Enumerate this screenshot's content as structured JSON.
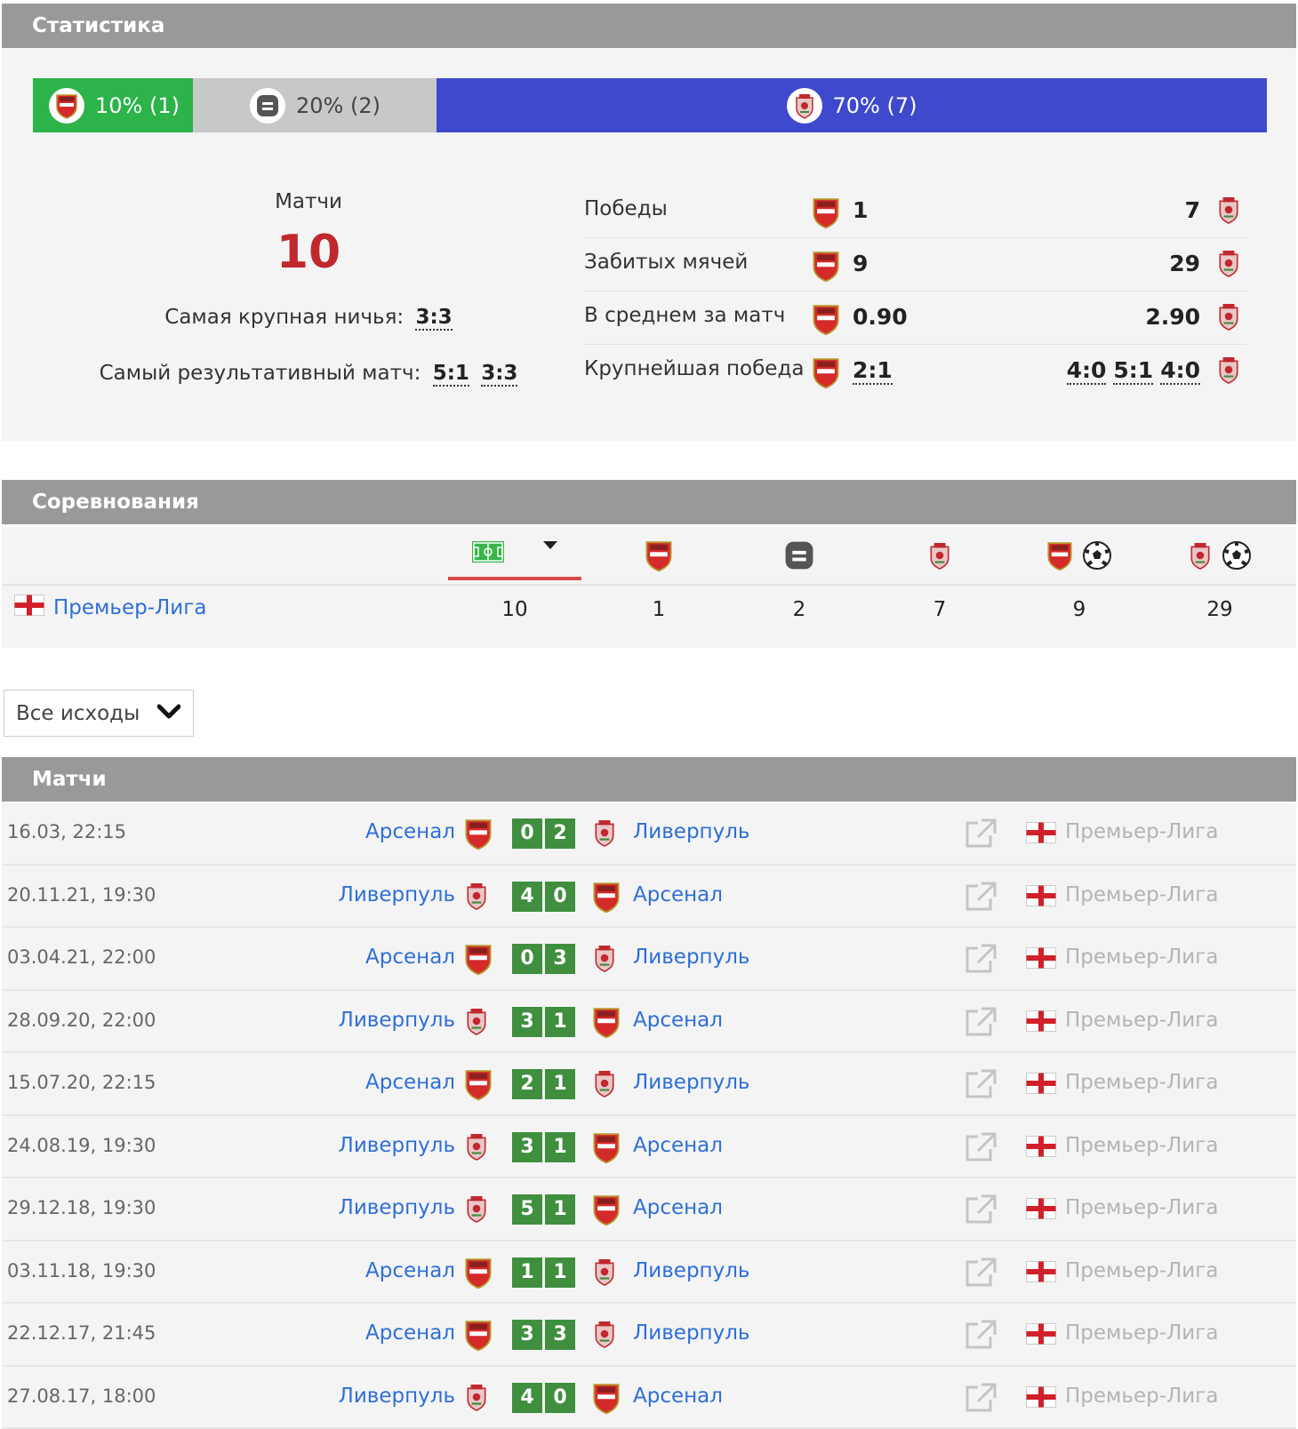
{
  "stats": {
    "header": "Статистика",
    "ratio": [
      {
        "label": "10% (1)",
        "percent": 10,
        "count": 1,
        "icon": "arsenal-crest-icon",
        "color": "#2cb34a"
      },
      {
        "label": "20% (2)",
        "percent": 20,
        "count": 2,
        "icon": "draw-icon",
        "color": "#c8c8c8"
      },
      {
        "label": "70% (7)",
        "percent": 70,
        "count": 7,
        "icon": "liverpool-crest-icon",
        "color": "#3e49cd"
      }
    ],
    "matches_label": "Матчи",
    "matches_count": "10",
    "biggest_draw_label": "Самая крупная ничья:",
    "biggest_draw_score": "3:3",
    "most_goals_label": "Самый результативный матч:",
    "most_goals_scores": [
      "5:1",
      "3:3"
    ],
    "rows": [
      {
        "name": "Победы",
        "left": "1",
        "right": [
          "7"
        ],
        "right_underlined": false,
        "left_underlined": false
      },
      {
        "name": "Забитых мячей",
        "left": "9",
        "right": [
          "29"
        ],
        "right_underlined": false,
        "left_underlined": false
      },
      {
        "name": "В среднем за матч",
        "left": "0.90",
        "right": [
          "2.90"
        ],
        "right_underlined": false,
        "left_underlined": false
      },
      {
        "name": "Крупнейшая победа",
        "left": "2:1",
        "right": [
          "4:0",
          "5:1",
          "4:0"
        ],
        "right_underlined": true,
        "left_underlined": true
      }
    ]
  },
  "competitions": {
    "header": "Соревнования",
    "columns": [
      "matches-field-icon",
      "arsenal-crest-icon",
      "draw-icon",
      "liverpool-crest-icon",
      "arsenal-goals-icon",
      "liverpool-goals-icon"
    ],
    "row": {
      "name": "Премьер-Лига",
      "values": [
        "10",
        "1",
        "2",
        "7",
        "9",
        "29"
      ]
    }
  },
  "filter": {
    "selected": "Все исходы"
  },
  "matches": {
    "header": "Матчи",
    "rows": [
      {
        "date": "16.03, 22:15",
        "home": "Арсенал",
        "away": "Ливерпуль",
        "home_score": "0",
        "away_score": "2",
        "league": "Премьер-Лига"
      },
      {
        "date": "20.11.21, 19:30",
        "home": "Ливерпуль",
        "away": "Арсенал",
        "home_score": "4",
        "away_score": "0",
        "league": "Премьер-Лига"
      },
      {
        "date": "03.04.21, 22:00",
        "home": "Арсенал",
        "away": "Ливерпуль",
        "home_score": "0",
        "away_score": "3",
        "league": "Премьер-Лига"
      },
      {
        "date": "28.09.20, 22:00",
        "home": "Ливерпуль",
        "away": "Арсенал",
        "home_score": "3",
        "away_score": "1",
        "league": "Премьер-Лига"
      },
      {
        "date": "15.07.20, 22:15",
        "home": "Арсенал",
        "away": "Ливерпуль",
        "home_score": "2",
        "away_score": "1",
        "league": "Премьер-Лига"
      },
      {
        "date": "24.08.19, 19:30",
        "home": "Ливерпуль",
        "away": "Арсенал",
        "home_score": "3",
        "away_score": "1",
        "league": "Премьер-Лига"
      },
      {
        "date": "29.12.18, 19:30",
        "home": "Ливерпуль",
        "away": "Арсенал",
        "home_score": "5",
        "away_score": "1",
        "league": "Премьер-Лига"
      },
      {
        "date": "03.11.18, 19:30",
        "home": "Арсенал",
        "away": "Ливерпуль",
        "home_score": "1",
        "away_score": "1",
        "league": "Премьер-Лига"
      },
      {
        "date": "22.12.17, 21:45",
        "home": "Арсенал",
        "away": "Ливерпуль",
        "home_score": "3",
        "away_score": "3",
        "league": "Премьер-Лига"
      },
      {
        "date": "27.08.17, 18:00",
        "home": "Ливерпуль",
        "away": "Арсенал",
        "home_score": "4",
        "away_score": "0",
        "league": "Премьер-Лига"
      }
    ]
  }
}
